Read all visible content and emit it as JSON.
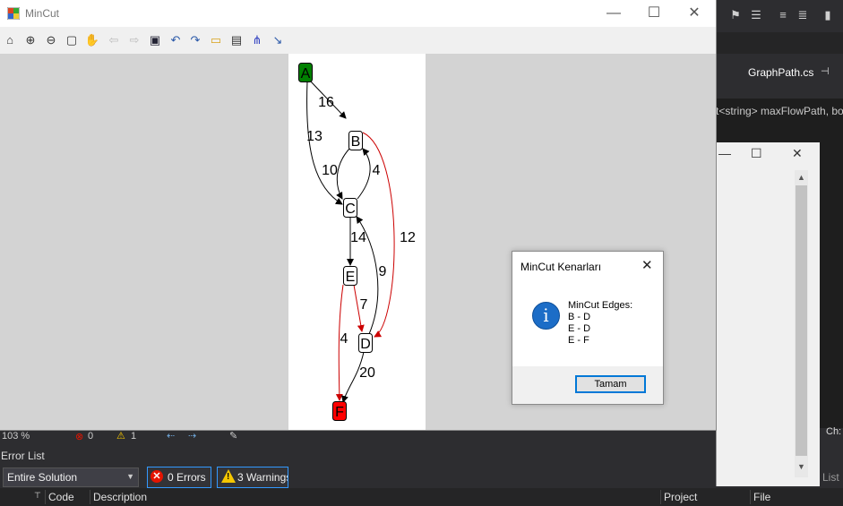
{
  "window": {
    "title": "MinCut",
    "minimize": "—",
    "maximize": "☐",
    "close": "✕"
  },
  "toolbar": {
    "items": [
      {
        "name": "home-icon",
        "glyph": "⌂"
      },
      {
        "name": "zoom-in-icon",
        "glyph": "⊕"
      },
      {
        "name": "zoom-out-icon",
        "glyph": "⊖"
      },
      {
        "name": "zoom-rect-icon",
        "glyph": "▢"
      },
      {
        "name": "pan-hand-icon",
        "glyph": "✋"
      },
      {
        "name": "back-arrow-icon",
        "glyph": "⇦"
      },
      {
        "name": "forward-arrow-icon",
        "glyph": "⇨"
      },
      {
        "name": "save-icon",
        "glyph": "▣"
      },
      {
        "name": "undo-icon",
        "glyph": "↶"
      },
      {
        "name": "redo-icon",
        "glyph": "↷"
      },
      {
        "name": "open-folder-icon",
        "glyph": "▭"
      },
      {
        "name": "print-icon",
        "glyph": "▤"
      },
      {
        "name": "layout-icon",
        "glyph": "⋔"
      },
      {
        "name": "edge-icon",
        "glyph": "↘"
      }
    ]
  },
  "graph": {
    "nodes": [
      {
        "id": "A",
        "fill": "#008000"
      },
      {
        "id": "B",
        "fill": "#ffffff"
      },
      {
        "id": "C",
        "fill": "#ffffff"
      },
      {
        "id": "E",
        "fill": "#ffffff"
      },
      {
        "id": "D",
        "fill": "#ffffff"
      },
      {
        "id": "F",
        "fill": "#ff0000"
      }
    ],
    "edges": [
      {
        "from": "A",
        "to": "B",
        "weight": "16",
        "color": "#000000"
      },
      {
        "from": "A",
        "to": "C",
        "weight": "13",
        "color": "#000000"
      },
      {
        "from": "B",
        "to": "C",
        "weight": "10",
        "color": "#000000"
      },
      {
        "from": "C",
        "to": "B",
        "weight": "4",
        "color": "#000000"
      },
      {
        "from": "B",
        "to": "D",
        "weight": "12",
        "color": "#cc0000"
      },
      {
        "from": "C",
        "to": "E",
        "weight": "14",
        "color": "#000000"
      },
      {
        "from": "D",
        "to": "C",
        "weight": "9",
        "color": "#000000"
      },
      {
        "from": "E",
        "to": "D",
        "weight": "7",
        "color": "#cc0000"
      },
      {
        "from": "E",
        "to": "F",
        "weight": "4",
        "color": "#cc0000"
      },
      {
        "from": "D",
        "to": "F",
        "weight": "20",
        "color": "#000000"
      }
    ]
  },
  "msgbox": {
    "title": "MinCut Kenarları",
    "close": "✕",
    "lines": [
      "MinCut Edges:",
      "B - D",
      "E - D",
      "E - F"
    ],
    "ok_label": "Tamam"
  },
  "vs": {
    "tab": "GraphPath.cs",
    "pin": "⊣",
    "code_snippet": "t<string> maxFlowPath, bo",
    "zoom": "103 %",
    "errors_status": "0",
    "warnings_status": "1",
    "error_list_title": "Error List",
    "scope": "Entire Solution",
    "errors_button": "0 Errors",
    "warnings_button": "3 Warnings",
    "columns": [
      "Code",
      "Description",
      "Project",
      "File"
    ],
    "right_status": "Ch:",
    "right_list": "List"
  }
}
